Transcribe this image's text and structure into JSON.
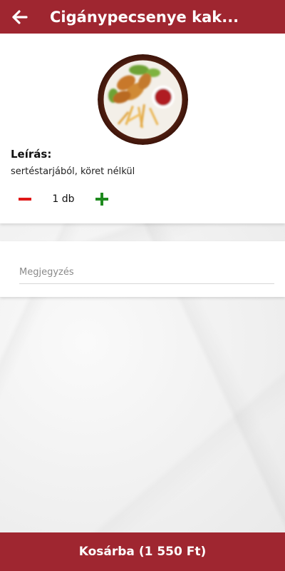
{
  "header": {
    "title": "Cigánypecsenye kak...",
    "back_icon": "arrow-left-icon"
  },
  "product": {
    "image_icon": "food-plate-image",
    "description_label": "Leírás:",
    "description": "sertéstarjából, köret nélkül",
    "quantity_text": "1 db"
  },
  "note": {
    "placeholder": "Megjegyzés",
    "value": ""
  },
  "cart": {
    "button_label": "Kosárba (1 550 Ft)"
  },
  "colors": {
    "brand": "#9f2630",
    "minus": "#e01818",
    "plus": "#1e8a1e"
  }
}
